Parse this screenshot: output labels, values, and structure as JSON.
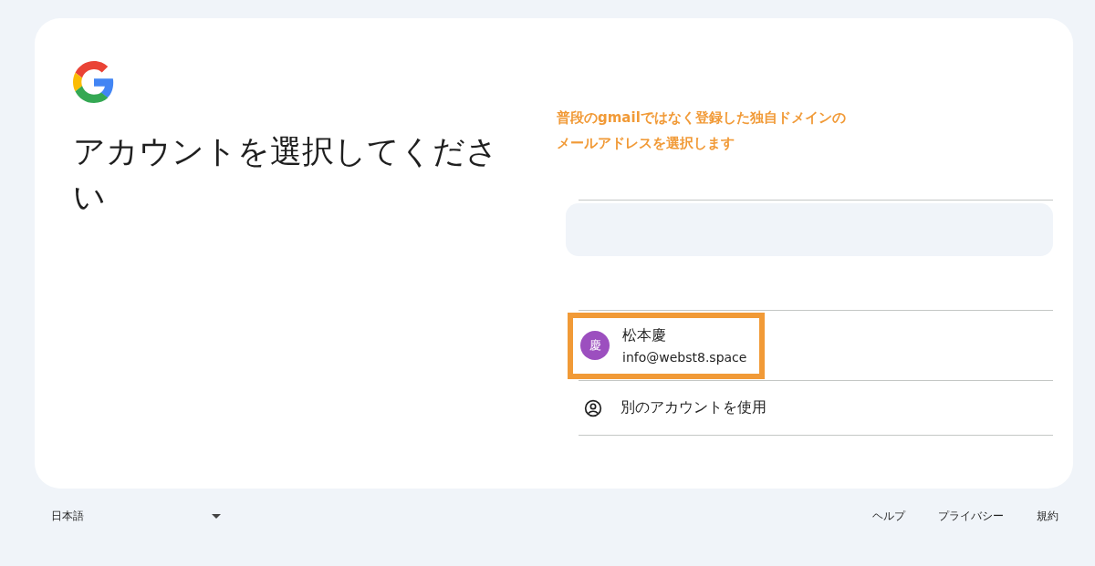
{
  "title": "アカウントを選択してください",
  "annotation": {
    "lines": [
      "普段のgmailではなく登録した独自ドメインの",
      "メールアドレスを選択します"
    ]
  },
  "accounts": [
    {
      "name": "松本慶",
      "email": "info@webst8.space",
      "avatar": "慶",
      "color": "#9c4fbf",
      "annotated": true
    }
  ],
  "other_account": "別のアカウントを使用",
  "footer": {
    "language": "日本語",
    "links": [
      "ヘルプ",
      "プライバシー",
      "規約"
    ]
  }
}
